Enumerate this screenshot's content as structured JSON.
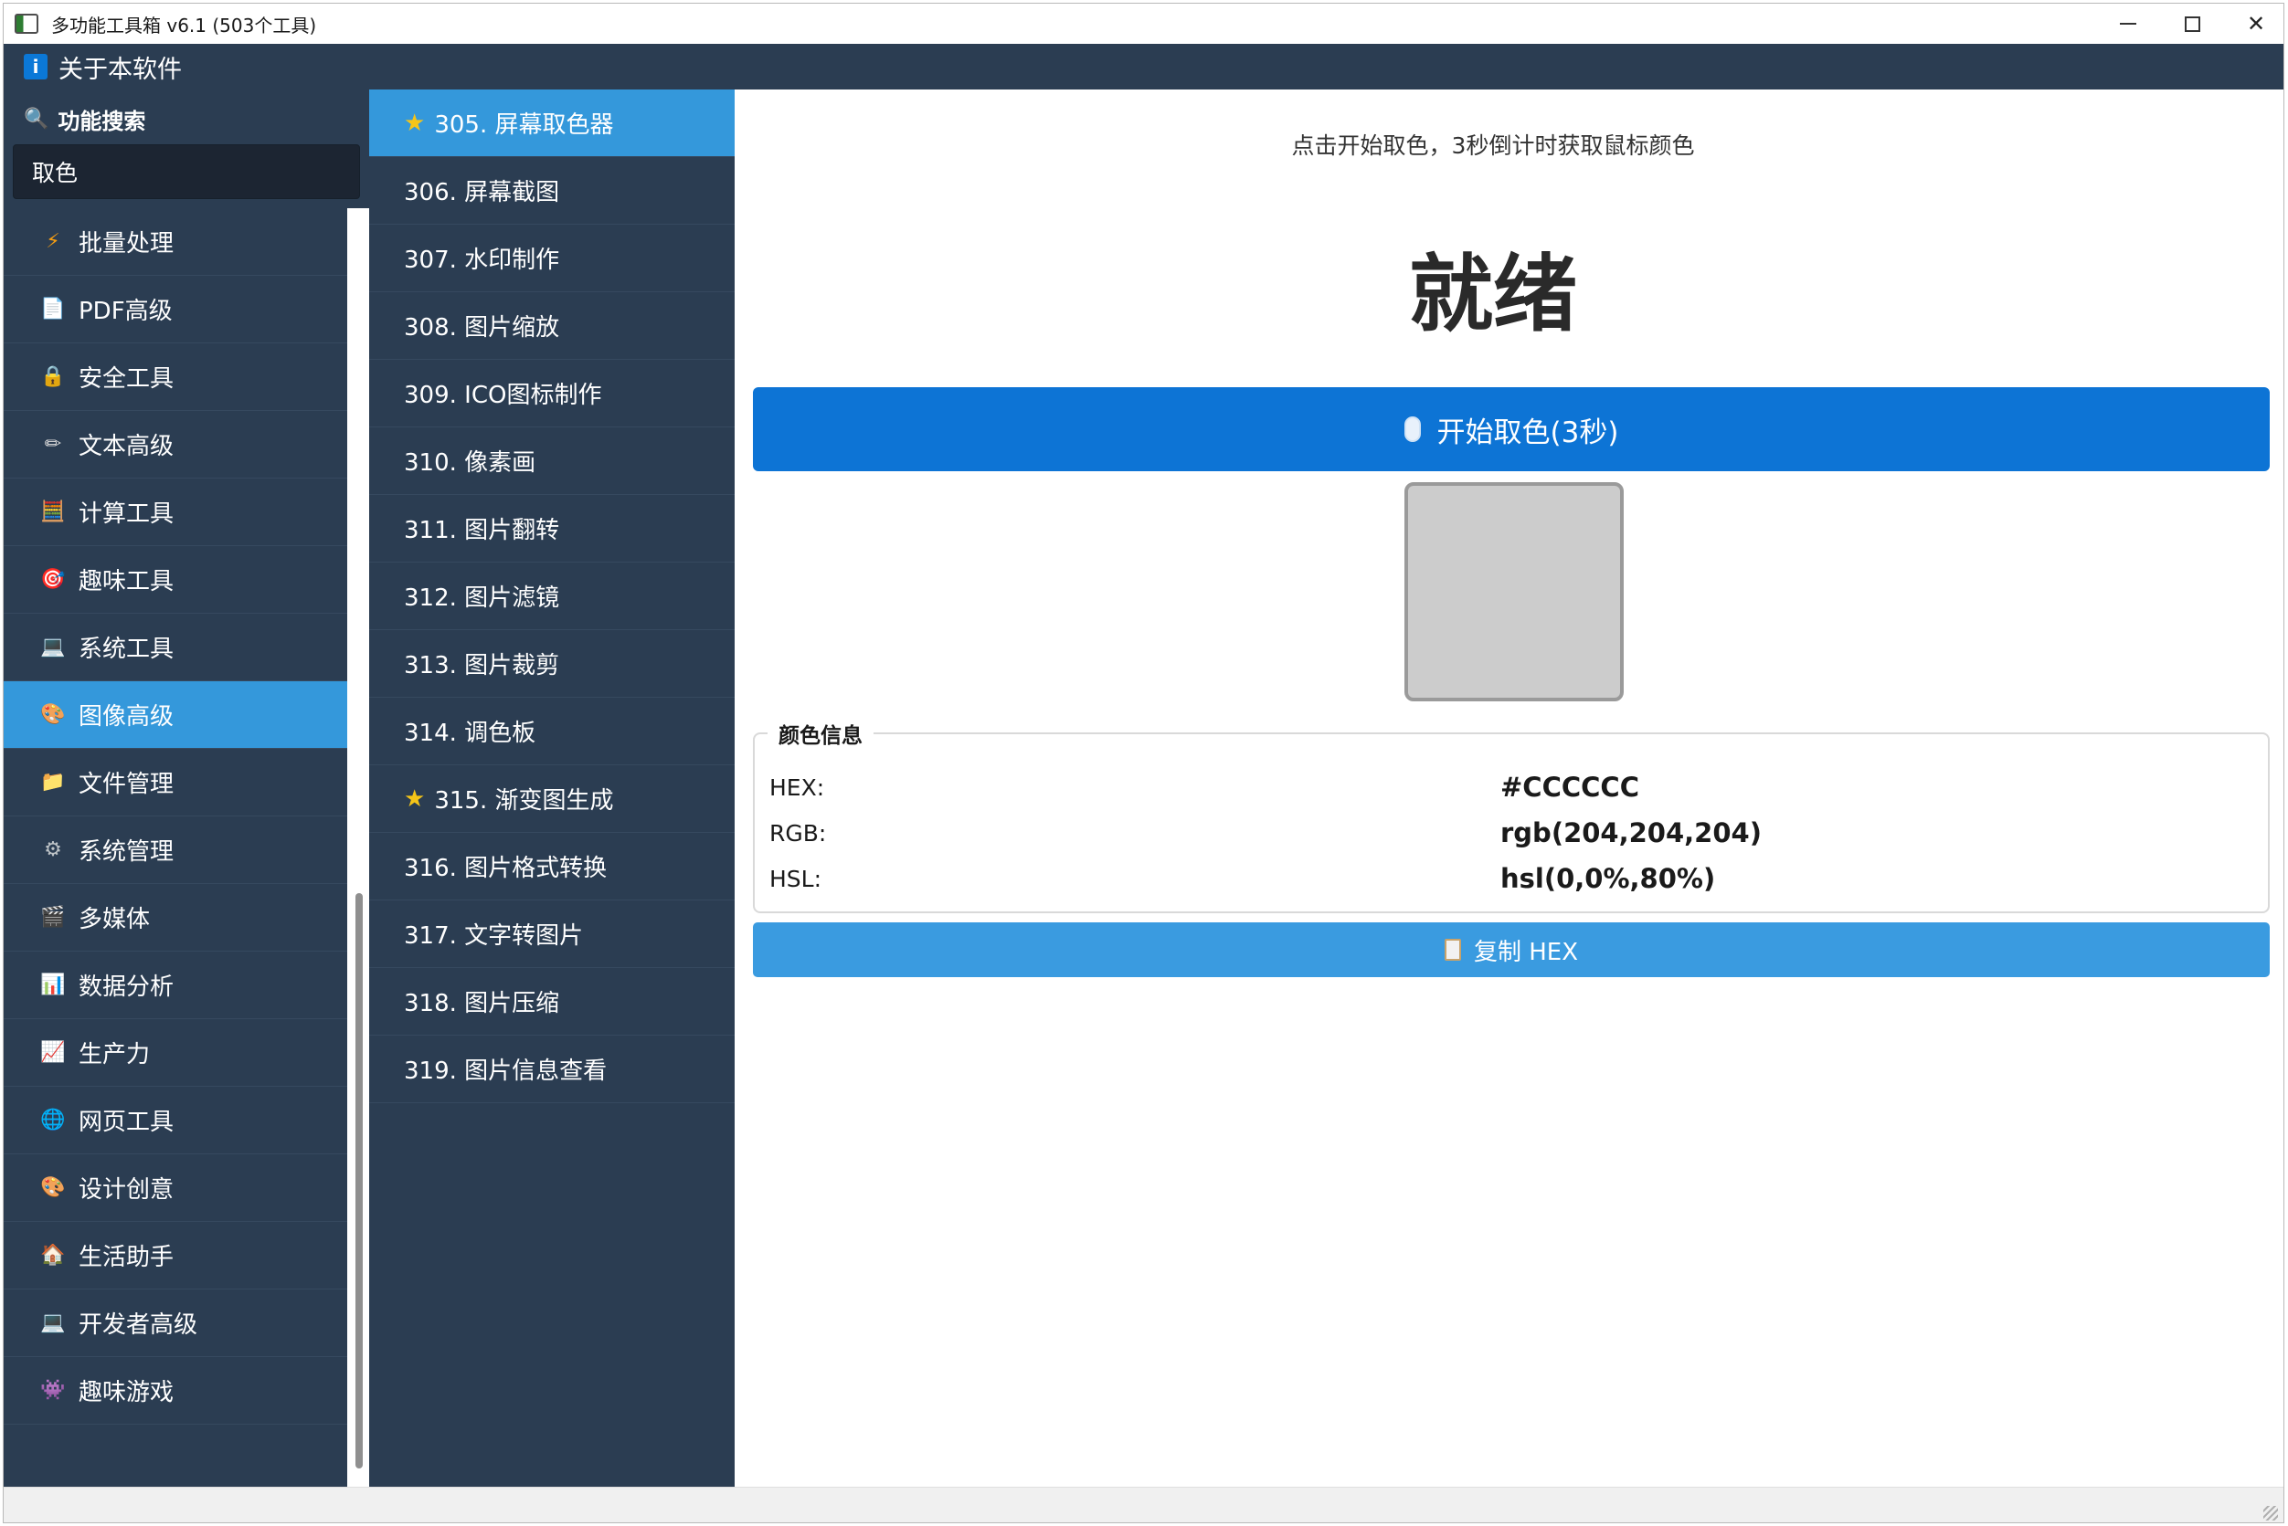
{
  "window": {
    "title": "多功能工具箱 v6.1 (503个工具)",
    "icon": "app-window-icon"
  },
  "menu": {
    "about_label": "关于本软件",
    "about_icon": "info-icon"
  },
  "sidebar": {
    "search_label": "功能搜索",
    "search_icon": "magnifier-icon",
    "search_value": "取色",
    "categories": [
      {
        "icon": "⚡",
        "icon_name": "lightning-icon",
        "label": "批量处理",
        "active": false,
        "color": "#f39c12"
      },
      {
        "icon": "📄",
        "icon_name": "document-icon",
        "label": "PDF高级",
        "active": false,
        "color": "#e8d39a"
      },
      {
        "icon": "🔒",
        "icon_name": "lock-icon",
        "label": "安全工具",
        "active": false,
        "color": "#f1c40f"
      },
      {
        "icon": "✏",
        "icon_name": "pencil-icon",
        "label": "文本高级",
        "active": false,
        "color": "#dddddd"
      },
      {
        "icon": "🧮",
        "icon_name": "abacus-icon",
        "label": "计算工具",
        "active": false,
        "color": "#e67e22"
      },
      {
        "icon": "🎯",
        "icon_name": "target-icon",
        "label": "趣味工具",
        "active": false,
        "color": "#e74c3c"
      },
      {
        "icon": "💻",
        "icon_name": "monitor-icon",
        "label": "系统工具",
        "active": false,
        "color": "#3498db"
      },
      {
        "icon": "🎨",
        "icon_name": "palette-icon",
        "label": "图像高级",
        "active": true,
        "color": "#f5b7b1"
      },
      {
        "icon": "📁",
        "icon_name": "folder-icon",
        "label": "文件管理",
        "active": false,
        "color": "#f1c40f"
      },
      {
        "icon": "⚙",
        "icon_name": "gear-icon",
        "label": "系统管理",
        "active": false,
        "color": "#bdc3c7"
      },
      {
        "icon": "🎬",
        "icon_name": "clapper-icon",
        "label": "多媒体",
        "active": false,
        "color": "#9b59b6"
      },
      {
        "icon": "📊",
        "icon_name": "bar-chart-icon",
        "label": "数据分析",
        "active": false,
        "color": "#2ecc71"
      },
      {
        "icon": "📈",
        "icon_name": "line-chart-icon",
        "label": "生产力",
        "active": false,
        "color": "#e74c3c"
      },
      {
        "icon": "🌐",
        "icon_name": "globe-icon",
        "label": "网页工具",
        "active": false,
        "color": "#5dade2"
      },
      {
        "icon": "🎨",
        "icon_name": "palette-icon",
        "label": "设计创意",
        "active": false,
        "color": "#f5b7b1"
      },
      {
        "icon": "🏠",
        "icon_name": "house-icon",
        "label": "生活助手",
        "active": false,
        "color": "#e67e22"
      },
      {
        "icon": "💻",
        "icon_name": "laptop-icon",
        "label": "开发者高级",
        "active": false,
        "color": "#3498db"
      },
      {
        "icon": "👾",
        "icon_name": "game-icon",
        "label": "趣味游戏",
        "active": false,
        "color": "#8e44ad"
      }
    ]
  },
  "tools": [
    {
      "label": "305. 屏幕取色器",
      "star": true,
      "active": true
    },
    {
      "label": "306. 屏幕截图",
      "star": false,
      "active": false
    },
    {
      "label": "307. 水印制作",
      "star": false,
      "active": false
    },
    {
      "label": "308. 图片缩放",
      "star": false,
      "active": false
    },
    {
      "label": "309. ICO图标制作",
      "star": false,
      "active": false
    },
    {
      "label": "310. 像素画",
      "star": false,
      "active": false
    },
    {
      "label": "311. 图片翻转",
      "star": false,
      "active": false
    },
    {
      "label": "312. 图片滤镜",
      "star": false,
      "active": false
    },
    {
      "label": "313. 图片裁剪",
      "star": false,
      "active": false
    },
    {
      "label": "314. 调色板",
      "star": false,
      "active": false
    },
    {
      "label": "315. 渐变图生成",
      "star": true,
      "active": false
    },
    {
      "label": "316. 图片格式转换",
      "star": false,
      "active": false
    },
    {
      "label": "317. 文字转图片",
      "star": false,
      "active": false
    },
    {
      "label": "318. 图片压缩",
      "star": false,
      "active": false
    },
    {
      "label": "319. 图片信息查看",
      "star": false,
      "active": false
    }
  ],
  "main": {
    "instruction": "点击开始取色，3秒倒计时获取鼠标颜色",
    "status": "就绪",
    "start_button": "开始取色(3秒)",
    "start_icon": "mouse-icon",
    "swatch_color": "#CCCCCC",
    "info_title": "颜色信息",
    "info": {
      "hex_label": "HEX:",
      "hex_value": "#CCCCCC",
      "rgb_label": "RGB:",
      "rgb_value": "rgb(204,204,204)",
      "hsl_label": "HSL:",
      "hsl_value": "hsl(0,0%,80%)"
    },
    "copy_button": "复制 HEX",
    "copy_icon": "clipboard-icon"
  },
  "colors": {
    "sidebar_bg": "#2b3d52",
    "accent": "#3498db",
    "primary_button": "#0d74d5",
    "star": "#f5c518"
  }
}
